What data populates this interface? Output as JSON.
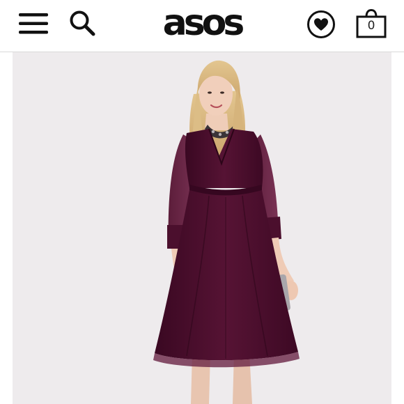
{
  "header": {
    "logo_text": "asos",
    "bag_count": "0",
    "icons": {
      "menu": "hamburger-menu-icon",
      "search": "search-icon",
      "saved": "heart-icon",
      "bag": "shopping-bag-icon"
    }
  },
  "product": {
    "image": "model-wearing-burgundy-wrap-dress",
    "colors": {
      "dress": "#4a0d2c",
      "background": "#eeebed"
    }
  },
  "colors": {
    "header_bg": "#ffffff",
    "icon": "#111111",
    "divider": "#d9d9d9"
  }
}
